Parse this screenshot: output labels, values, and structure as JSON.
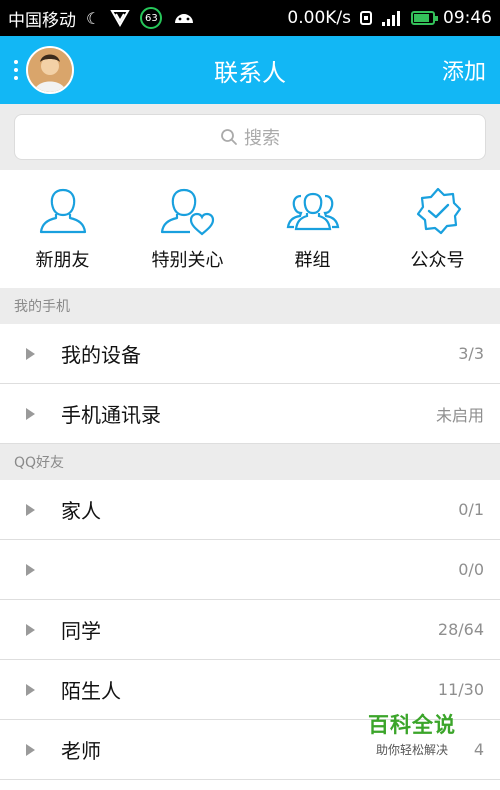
{
  "status_bar": {
    "carrier": "中国移动",
    "badge": "63",
    "network_speed": "0.00K/s",
    "time": "09:46",
    "battery_color": "#34c15a"
  },
  "header": {
    "title": "联系人",
    "add_label": "添加",
    "bg_color": "#12b7f5"
  },
  "search": {
    "placeholder": "搜索"
  },
  "quick_actions": [
    {
      "label": "新朋友",
      "icon": "person-icon"
    },
    {
      "label": "特别关心",
      "icon": "person-heart-icon"
    },
    {
      "label": "群组",
      "icon": "group-icon"
    },
    {
      "label": "公众号",
      "icon": "verified-badge-icon"
    }
  ],
  "sections": [
    {
      "title": "我的手机",
      "rows": [
        {
          "name": "我的设备",
          "count": "3/3"
        },
        {
          "name": "手机通讯录",
          "count": "未启用"
        }
      ]
    },
    {
      "title": "QQ好友",
      "rows": [
        {
          "name": "家人",
          "count": "0/1"
        },
        {
          "name": "",
          "count": "0/0"
        },
        {
          "name": "同学",
          "count": "28/64"
        },
        {
          "name": "陌生人",
          "count": "11/30"
        },
        {
          "name": "老师",
          "count": "4"
        }
      ]
    }
  ],
  "watermark": {
    "brand": "百科全说",
    "tagline": "助你轻松解决"
  }
}
